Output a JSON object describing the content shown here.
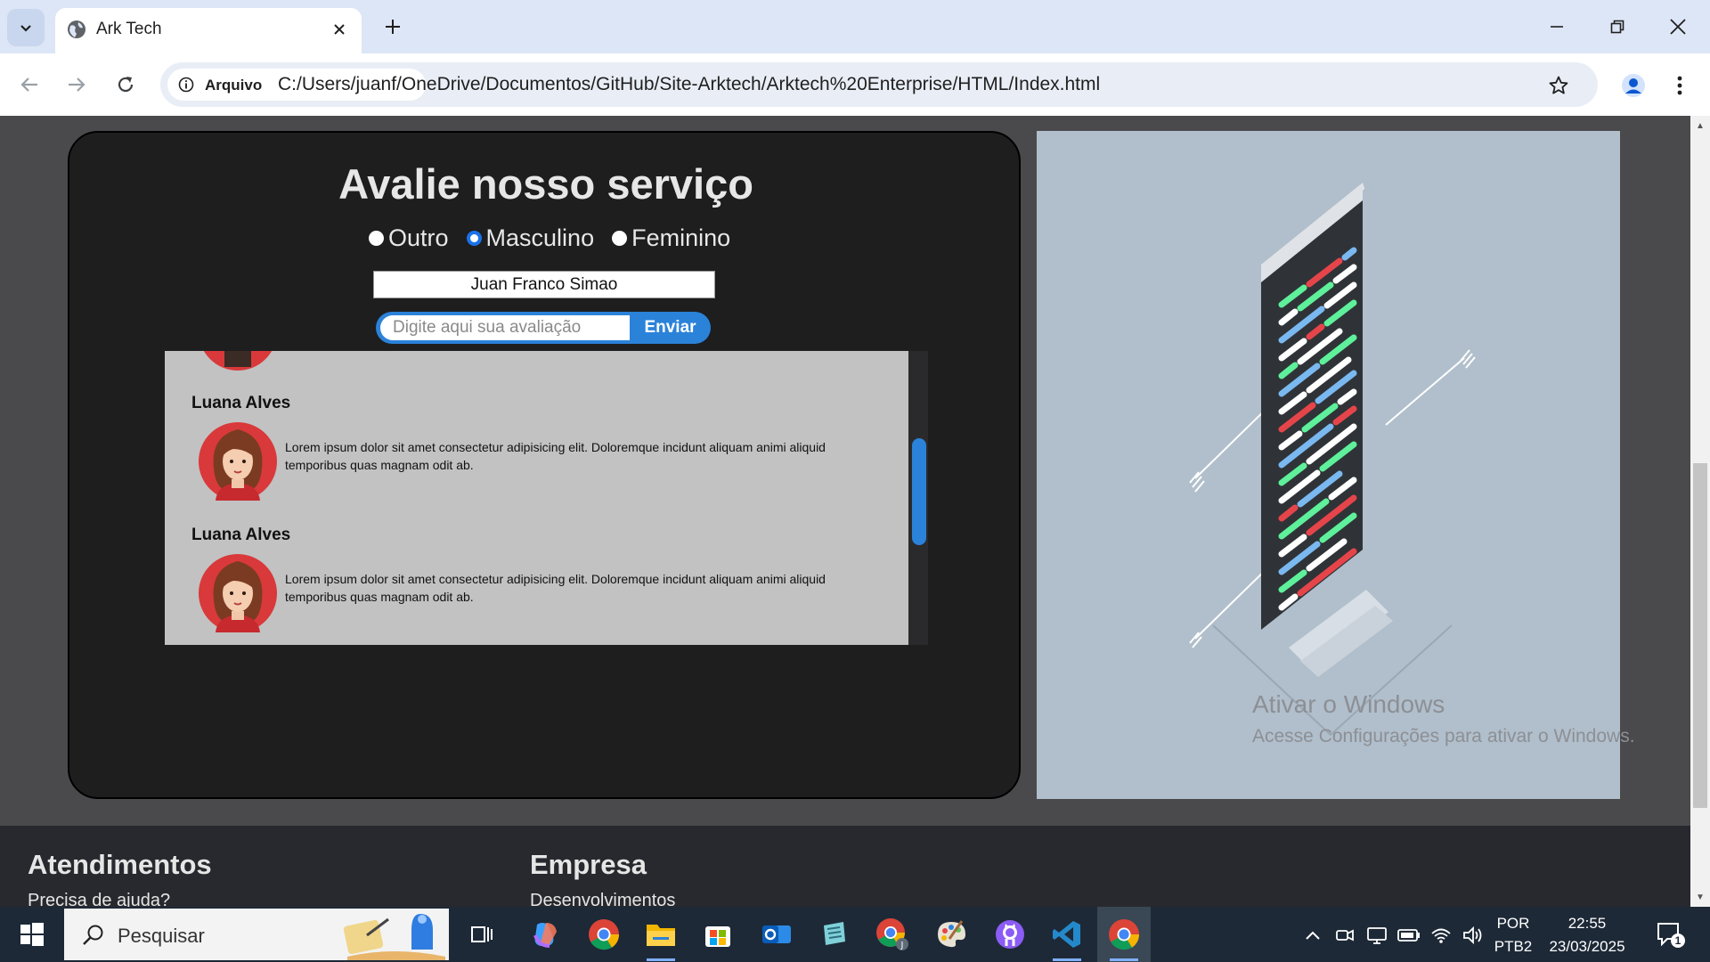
{
  "browser": {
    "tab_title": "Ark Tech",
    "site_chip_label": "Arquivo",
    "url": "C:/Users/juanf/OneDrive/Documentos/GitHub/Site-Arktech/Arktech%20Enterprise/HTML/Index.html"
  },
  "review": {
    "title": "Avalie nosso serviço",
    "gender_options": [
      {
        "label": "Outro",
        "checked": false
      },
      {
        "label": "Masculino",
        "checked": true
      },
      {
        "label": "Feminino",
        "checked": false
      }
    ],
    "name_value": "Juan Franco Simao",
    "review_placeholder": "Digite aqui sua avaliação",
    "send_label": "Enviar",
    "comments": [
      {
        "name": "Luana Alves",
        "text": "Lorem ipsum dolor sit amet consectetur adipisicing elit. Doloremque incidunt aliquam animi aliquid temporibus quas magnam odit ab."
      },
      {
        "name": "Luana Alves",
        "text": "Lorem ipsum dolor sit amet consectetur adipisicing elit. Doloremque incidunt aliquam animi aliquid temporibus quas magnam odit ab."
      }
    ]
  },
  "footer": {
    "col1_heading": "Atendimentos",
    "col1_link": "Precisa de ajuda?",
    "col2_heading": "Empresa",
    "col2_link": "Desenvolvimentos"
  },
  "watermark": {
    "title": "Ativar o Windows",
    "subtitle": "Acesse Configurações para ativar o Windows."
  },
  "taskbar": {
    "search_placeholder": "Pesquisar",
    "language_top": "POR",
    "language_bottom": "PTB2",
    "time": "22:55",
    "date": "23/03/2025",
    "notification_count": "1"
  },
  "colors": {
    "accent_blue": "#2b82d9",
    "card_bg": "#1e1e1f",
    "comments_bg": "#c2c2c2",
    "illustration_bg": "#b0bfcb"
  }
}
